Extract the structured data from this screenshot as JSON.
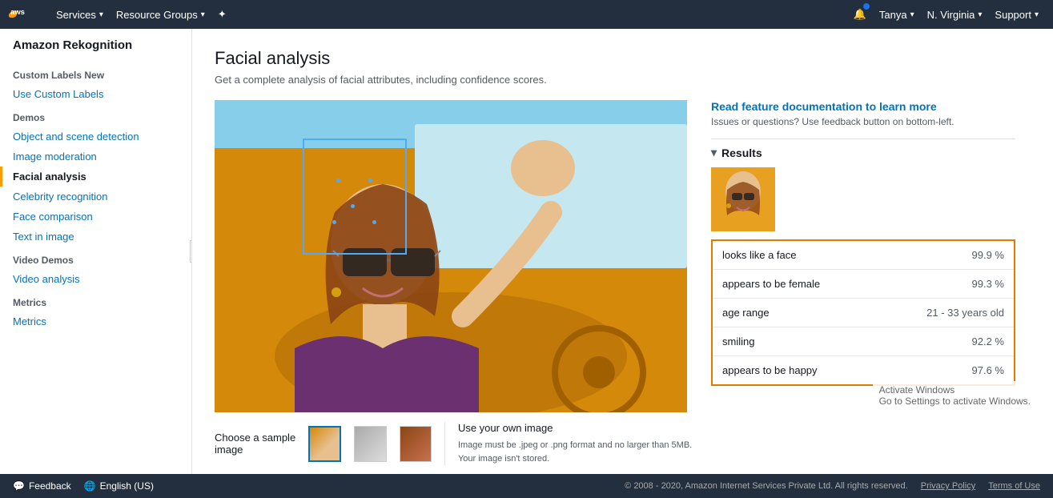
{
  "topNav": {
    "logo_text": "aws",
    "services_label": "Services",
    "resource_groups_label": "Resource Groups",
    "user_label": "Tanya",
    "region_label": "N. Virginia",
    "support_label": "Support"
  },
  "sidebar": {
    "title": "Amazon Rekognition",
    "custom_labels": {
      "section_label": "Custom Labels",
      "badge": "New",
      "use_link": "Use Custom Labels"
    },
    "demos_label": "Demos",
    "demos_items": [
      {
        "label": "Object and scene detection",
        "active": false
      },
      {
        "label": "Image moderation",
        "active": false
      },
      {
        "label": "Facial analysis",
        "active": true
      },
      {
        "label": "Celebrity recognition",
        "active": false
      },
      {
        "label": "Face comparison",
        "active": false
      },
      {
        "label": "Text in image",
        "active": false
      }
    ],
    "video_demos_label": "Video Demos",
    "video_items": [
      {
        "label": "Video analysis",
        "active": false
      }
    ],
    "metrics_label": "Metrics",
    "metrics_items": [
      {
        "label": "Metrics",
        "active": false
      }
    ]
  },
  "page": {
    "title": "Facial analysis",
    "subtitle": "Get a complete analysis of facial attributes, including confidence scores.",
    "docs_link": "Read feature documentation to learn more",
    "docs_hint": "Issues or questions? Use feedback button on bottom-left.",
    "results_label": "Results",
    "sample_images_label": "Choose a sample image",
    "own_image_label": "Use your own image",
    "own_image_note": "Image must be .jpeg or .png format and no larger than 5MB. Your image isn't stored."
  },
  "results": {
    "rows": [
      {
        "label": "looks like a face",
        "value": "99.9 %"
      },
      {
        "label": "appears to be female",
        "value": "99.3 %"
      },
      {
        "label": "age range",
        "value": "21 - 33 years old"
      },
      {
        "label": "smiling",
        "value": "92.2 %"
      },
      {
        "label": "appears to be happy",
        "value": "97.6 %"
      }
    ]
  },
  "footer": {
    "feedback_label": "Feedback",
    "language_label": "English (US)",
    "copyright": "© 2008 - 2020, Amazon Internet Services Private Ltd. All rights reserved.",
    "privacy_label": "Privacy Policy",
    "terms_label": "Terms of Use"
  }
}
